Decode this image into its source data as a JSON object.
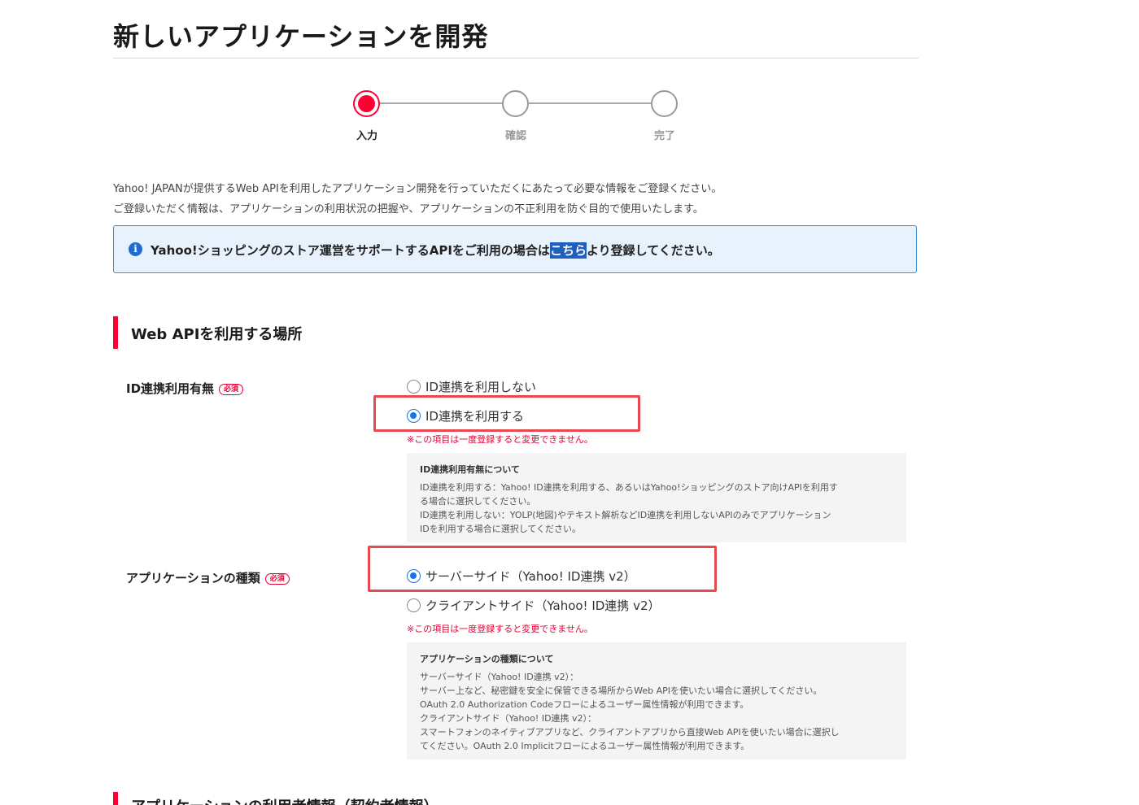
{
  "page_title": "新しいアプリケーションを開発",
  "stepper": {
    "steps": [
      {
        "label": "入力",
        "active": true
      },
      {
        "label": "確認",
        "active": false
      },
      {
        "label": "完了",
        "active": false
      }
    ]
  },
  "intro": {
    "line1": "Yahoo! JAPANが提供するWeb APIを利用したアプリケーション開発を行っていただくにあたって必要な情報をご登録ください。",
    "line2": "ご登録いただく情報は、アプリケーションの利用状況の把握や、アプリケーションの不正利用を防ぐ目的で使用いたします。"
  },
  "notice": {
    "icon": "info-icon",
    "prefix": "Yahoo!ショッピングのストア運営をサポートするAPIをご利用の場合は",
    "link": "こちら",
    "suffix": "より登録してください。"
  },
  "section1": {
    "title": "Web APIを利用する場所"
  },
  "id_link": {
    "label": "ID連携利用有無",
    "required": "必須",
    "options": [
      {
        "label": "ID連携を利用しない",
        "checked": false
      },
      {
        "label": "ID連携を利用する",
        "checked": true
      }
    ],
    "warning": "※この項目は一度登録すると変更できません。",
    "help_title": "ID連携利用有無について",
    "help_lines": [
      "ID連携を利用する：Yahoo! ID連携を利用する、あるいはYahoo!ショッピングのストア向けAPIを利用す",
      "る場合に選択してください。",
      "ID連携を利用しない：YOLP(地図)やテキスト解析などID連携を利用しないAPIのみでアプリケーション",
      "IDを利用する場合に選択してください。"
    ]
  },
  "app_type": {
    "label": "アプリケーションの種類",
    "required": "必須",
    "options": [
      {
        "label": "サーバーサイド（Yahoo! ID連携 v2）",
        "checked": true
      },
      {
        "label": "クライアントサイド（Yahoo! ID連携 v2）",
        "checked": false
      }
    ],
    "warning": "※この項目は一度登録すると変更できません。",
    "help_title": "アプリケーションの種類について",
    "help_lines": [
      "サーバーサイド（Yahoo! ID連携 v2）：",
      "サーバー上など、秘密鍵を安全に保管できる場所からWeb APIを使いたい場合に選択してください。",
      "OAuth 2.0 Authorization Codeフローによるユーザー属性情報が利用できます。",
      "クライアントサイド（Yahoo! ID連携 v2）：",
      "スマートフォンのネイティブアプリなど、クライアントアプリから直接Web APIを使いたい場合に選択し",
      "てください。OAuth 2.0 Implicitフローによるユーザー属性情報が利用できます。"
    ]
  },
  "section2": {
    "title": "アプリケーションの利用者情報（契約者情報）"
  },
  "colors": {
    "accent_red": "#ff0033",
    "link_blue": "#1f5fbf",
    "highlight": "#e8484f"
  }
}
